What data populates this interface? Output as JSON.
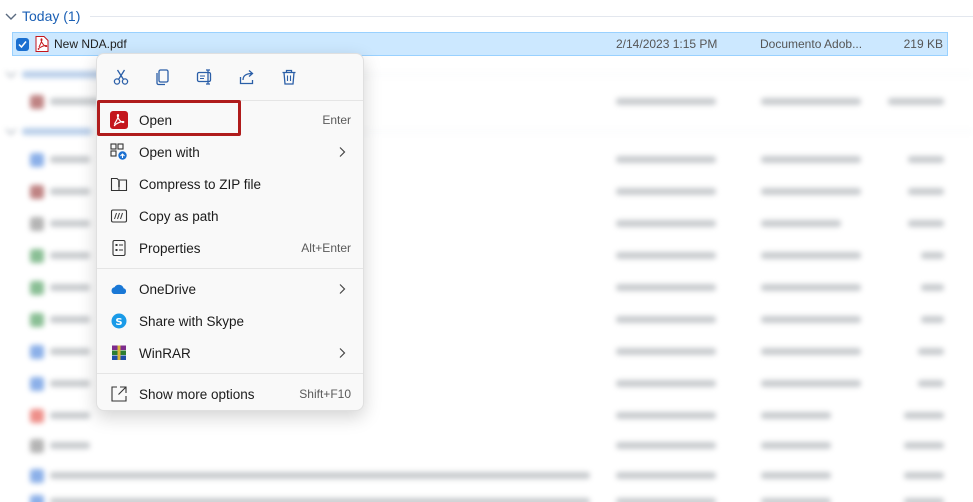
{
  "groups": {
    "today": {
      "label": "Today (1)"
    },
    "last_month": {
      "label": ""
    },
    "long_ago": {
      "label": ""
    }
  },
  "selected_file": {
    "name": "New NDA.pdf",
    "date": "2/14/2023 1:15 PM",
    "type": "Documento Adob...",
    "size": "219 KB",
    "icon": "pdf-icon"
  },
  "context_menu": {
    "toolbar": [
      {
        "name": "cut-icon",
        "tooltip": "Cut"
      },
      {
        "name": "copy-icon",
        "tooltip": "Copy"
      },
      {
        "name": "rename-icon",
        "tooltip": "Rename"
      },
      {
        "name": "share-icon",
        "tooltip": "Share"
      },
      {
        "name": "delete-icon",
        "tooltip": "Delete"
      }
    ],
    "items": [
      {
        "label": "Open",
        "shortcut": "Enter",
        "icon": "acrobat-icon"
      },
      {
        "label": "Open with",
        "shortcut": "",
        "icon": "open-with-icon",
        "submenu": true
      },
      {
        "label": "Compress to ZIP file",
        "shortcut": "",
        "icon": "zip-icon"
      },
      {
        "label": "Copy as path",
        "shortcut": "",
        "icon": "copy-path-icon"
      },
      {
        "label": "Properties",
        "shortcut": "Alt+Enter",
        "icon": "properties-icon"
      },
      {
        "label": "OneDrive",
        "shortcut": "",
        "icon": "onedrive-icon",
        "submenu": true
      },
      {
        "label": "Share with Skype",
        "shortcut": "",
        "icon": "skype-icon"
      },
      {
        "label": "WinRAR",
        "shortcut": "",
        "icon": "winrar-icon",
        "submenu": true
      },
      {
        "label": "Show more options",
        "shortcut": "Shift+F10",
        "icon": "more-options-icon"
      }
    ]
  },
  "colors": {
    "accent": "#1a5fb4",
    "selection": "#cce8ff",
    "highlight_box": "#b01c1c",
    "pdf_red": "#c4161c"
  }
}
